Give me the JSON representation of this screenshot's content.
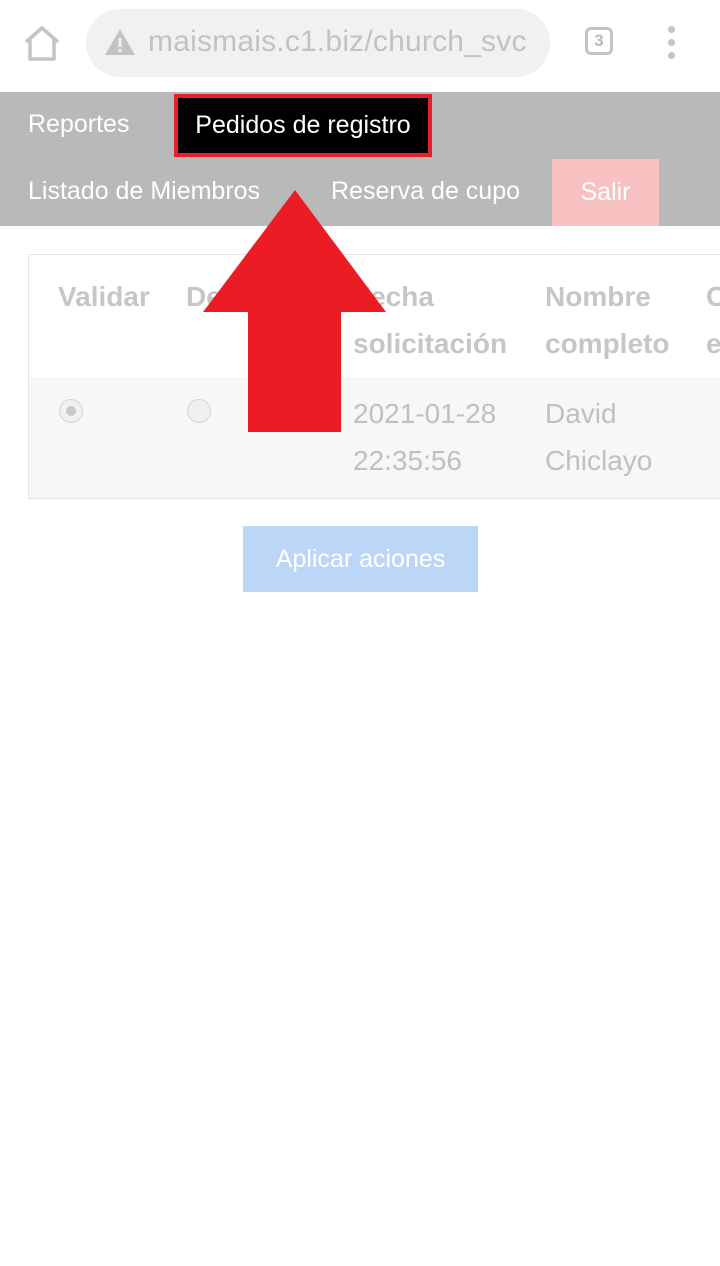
{
  "browser": {
    "url": "maismais.c1.biz/church_svc",
    "tab_count": "3",
    "icons": [
      "home-icon",
      "warning-icon",
      "tabs-icon",
      "more-vert-icon"
    ]
  },
  "nav": {
    "reportes": "Reportes",
    "pedidos": "Pedidos de registro",
    "listado": "Listado de Miembros",
    "reserva": "Reserva de cupo",
    "salir": "Salir"
  },
  "table": {
    "headers": {
      "validar": "Validar",
      "de": "De",
      "fecha_1": "Fecha",
      "fecha_2": "solicitación",
      "nombre_1": "Nombre",
      "nombre_2": "completo",
      "next_1": "C",
      "next_2": "e"
    },
    "rows": [
      {
        "validar_checked": true,
        "de_checked": false,
        "fecha_date": "2021-01-28",
        "fecha_time": "22:35:56",
        "nombre_first": "David",
        "nombre_last": "Chiclayo"
      }
    ]
  },
  "actions": {
    "apply": "Aplicar aciones"
  },
  "colors": {
    "nav_bg": "#b9b9b9",
    "active_tab_bg": "#000000",
    "active_tab_border": "#e4202a",
    "salir_bg": "#f7c1c1",
    "apply_bg": "#bcd6f7",
    "annotation_arrow": "#ec1c24"
  }
}
